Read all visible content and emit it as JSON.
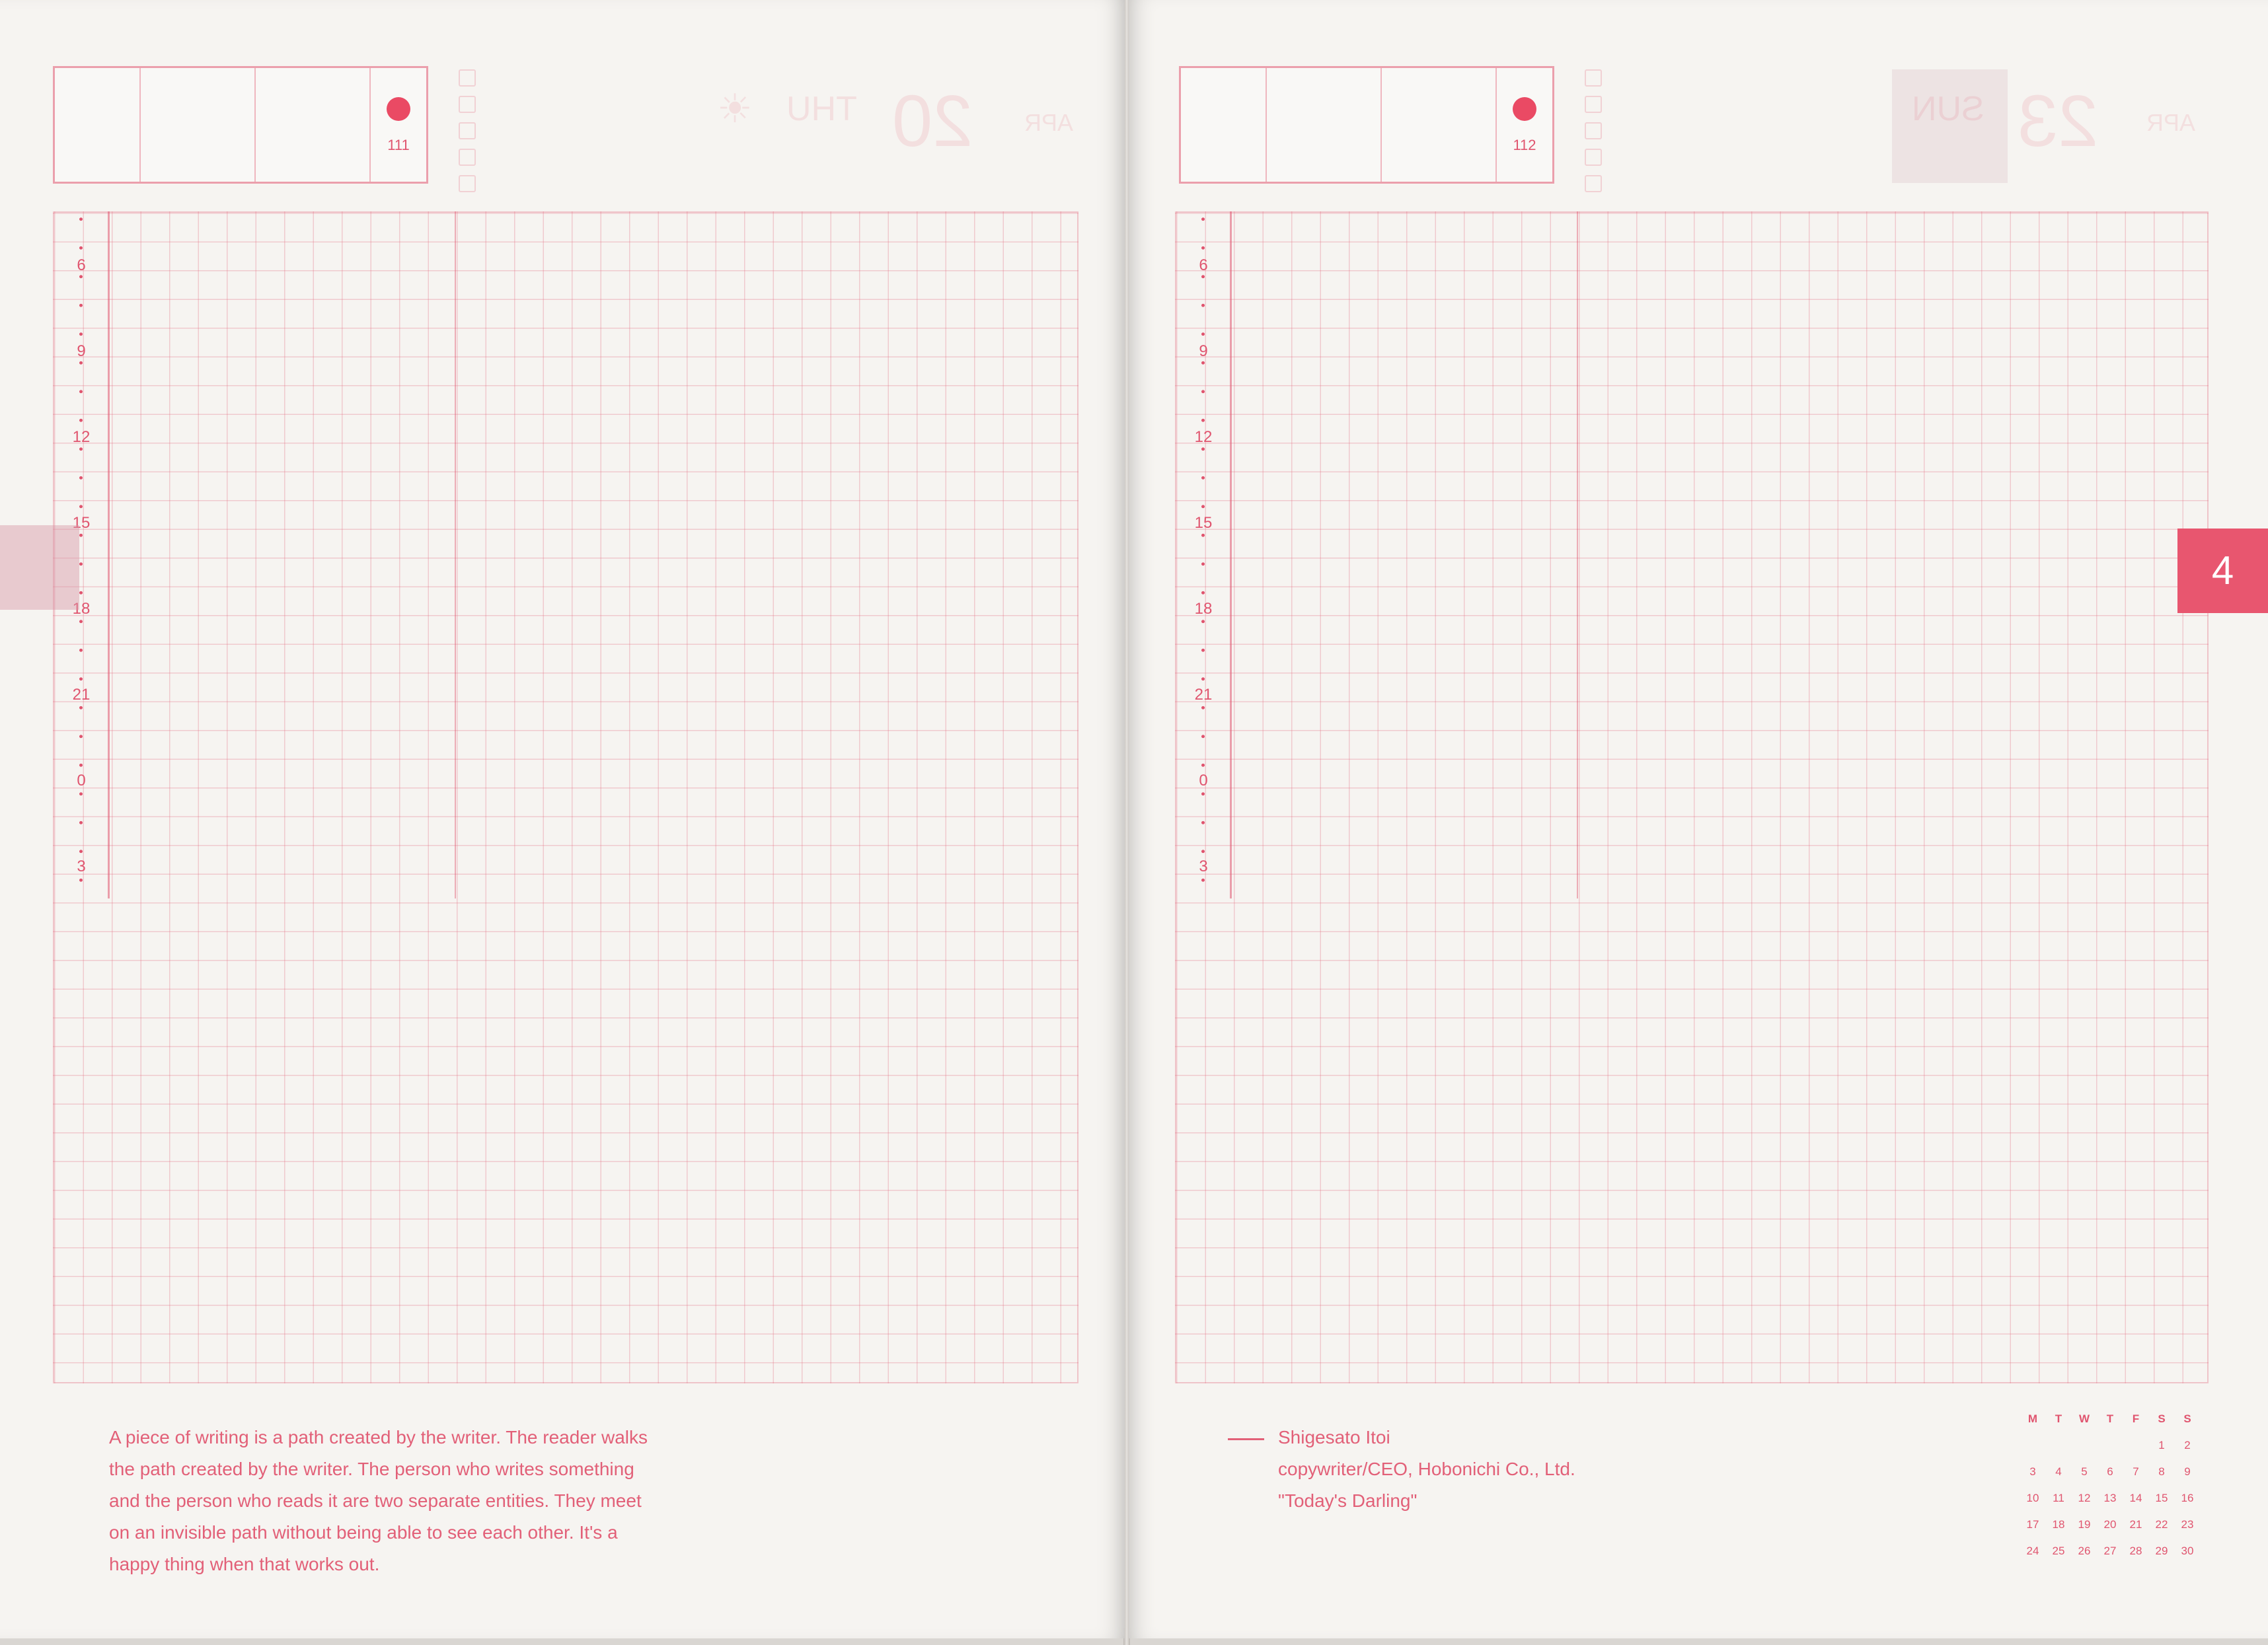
{
  "left_page": {
    "page_number": "111",
    "hours": [
      "6",
      "9",
      "12",
      "15",
      "18",
      "21",
      "0",
      "3"
    ],
    "ghost_month": "APR",
    "ghost_day": "20",
    "ghost_weekday": "THU",
    "quote_lines": [
      "A piece of writing is a path created by the writer. The reader walks",
      "the path created by the writer. The person who writes something",
      "and the person who reads it are two separate entities. They meet",
      "on an invisible path without being able to see each other. It's a",
      "happy thing when that works out."
    ]
  },
  "right_page": {
    "page_number": "112",
    "hours": [
      "6",
      "9",
      "12",
      "15",
      "18",
      "21",
      "0",
      "3"
    ],
    "ghost_month": "APR",
    "ghost_day": "23",
    "ghost_weekday": "SUN",
    "attribution_lines": [
      "Shigesato Itoi",
      "copywriter/CEO, Hobonichi Co., Ltd.",
      "\"Today's Darling\""
    ],
    "month_tab": "4",
    "mini_calendar": {
      "headers": [
        "M",
        "T",
        "W",
        "T",
        "F",
        "S",
        "S"
      ],
      "weeks": [
        [
          "",
          "",
          "",
          "",
          "",
          "1",
          "2"
        ],
        [
          "3",
          "4",
          "5",
          "6",
          "7",
          "8",
          "9"
        ],
        [
          "10",
          "11",
          "12",
          "13",
          "14",
          "15",
          "16"
        ],
        [
          "17",
          "18",
          "19",
          "20",
          "21",
          "22",
          "23"
        ],
        [
          "24",
          "25",
          "26",
          "27",
          "28",
          "29",
          "30"
        ]
      ]
    }
  },
  "colors": {
    "accent": "#e8566f",
    "paper": "#f6f4f1",
    "grid": "#e26a7e"
  }
}
